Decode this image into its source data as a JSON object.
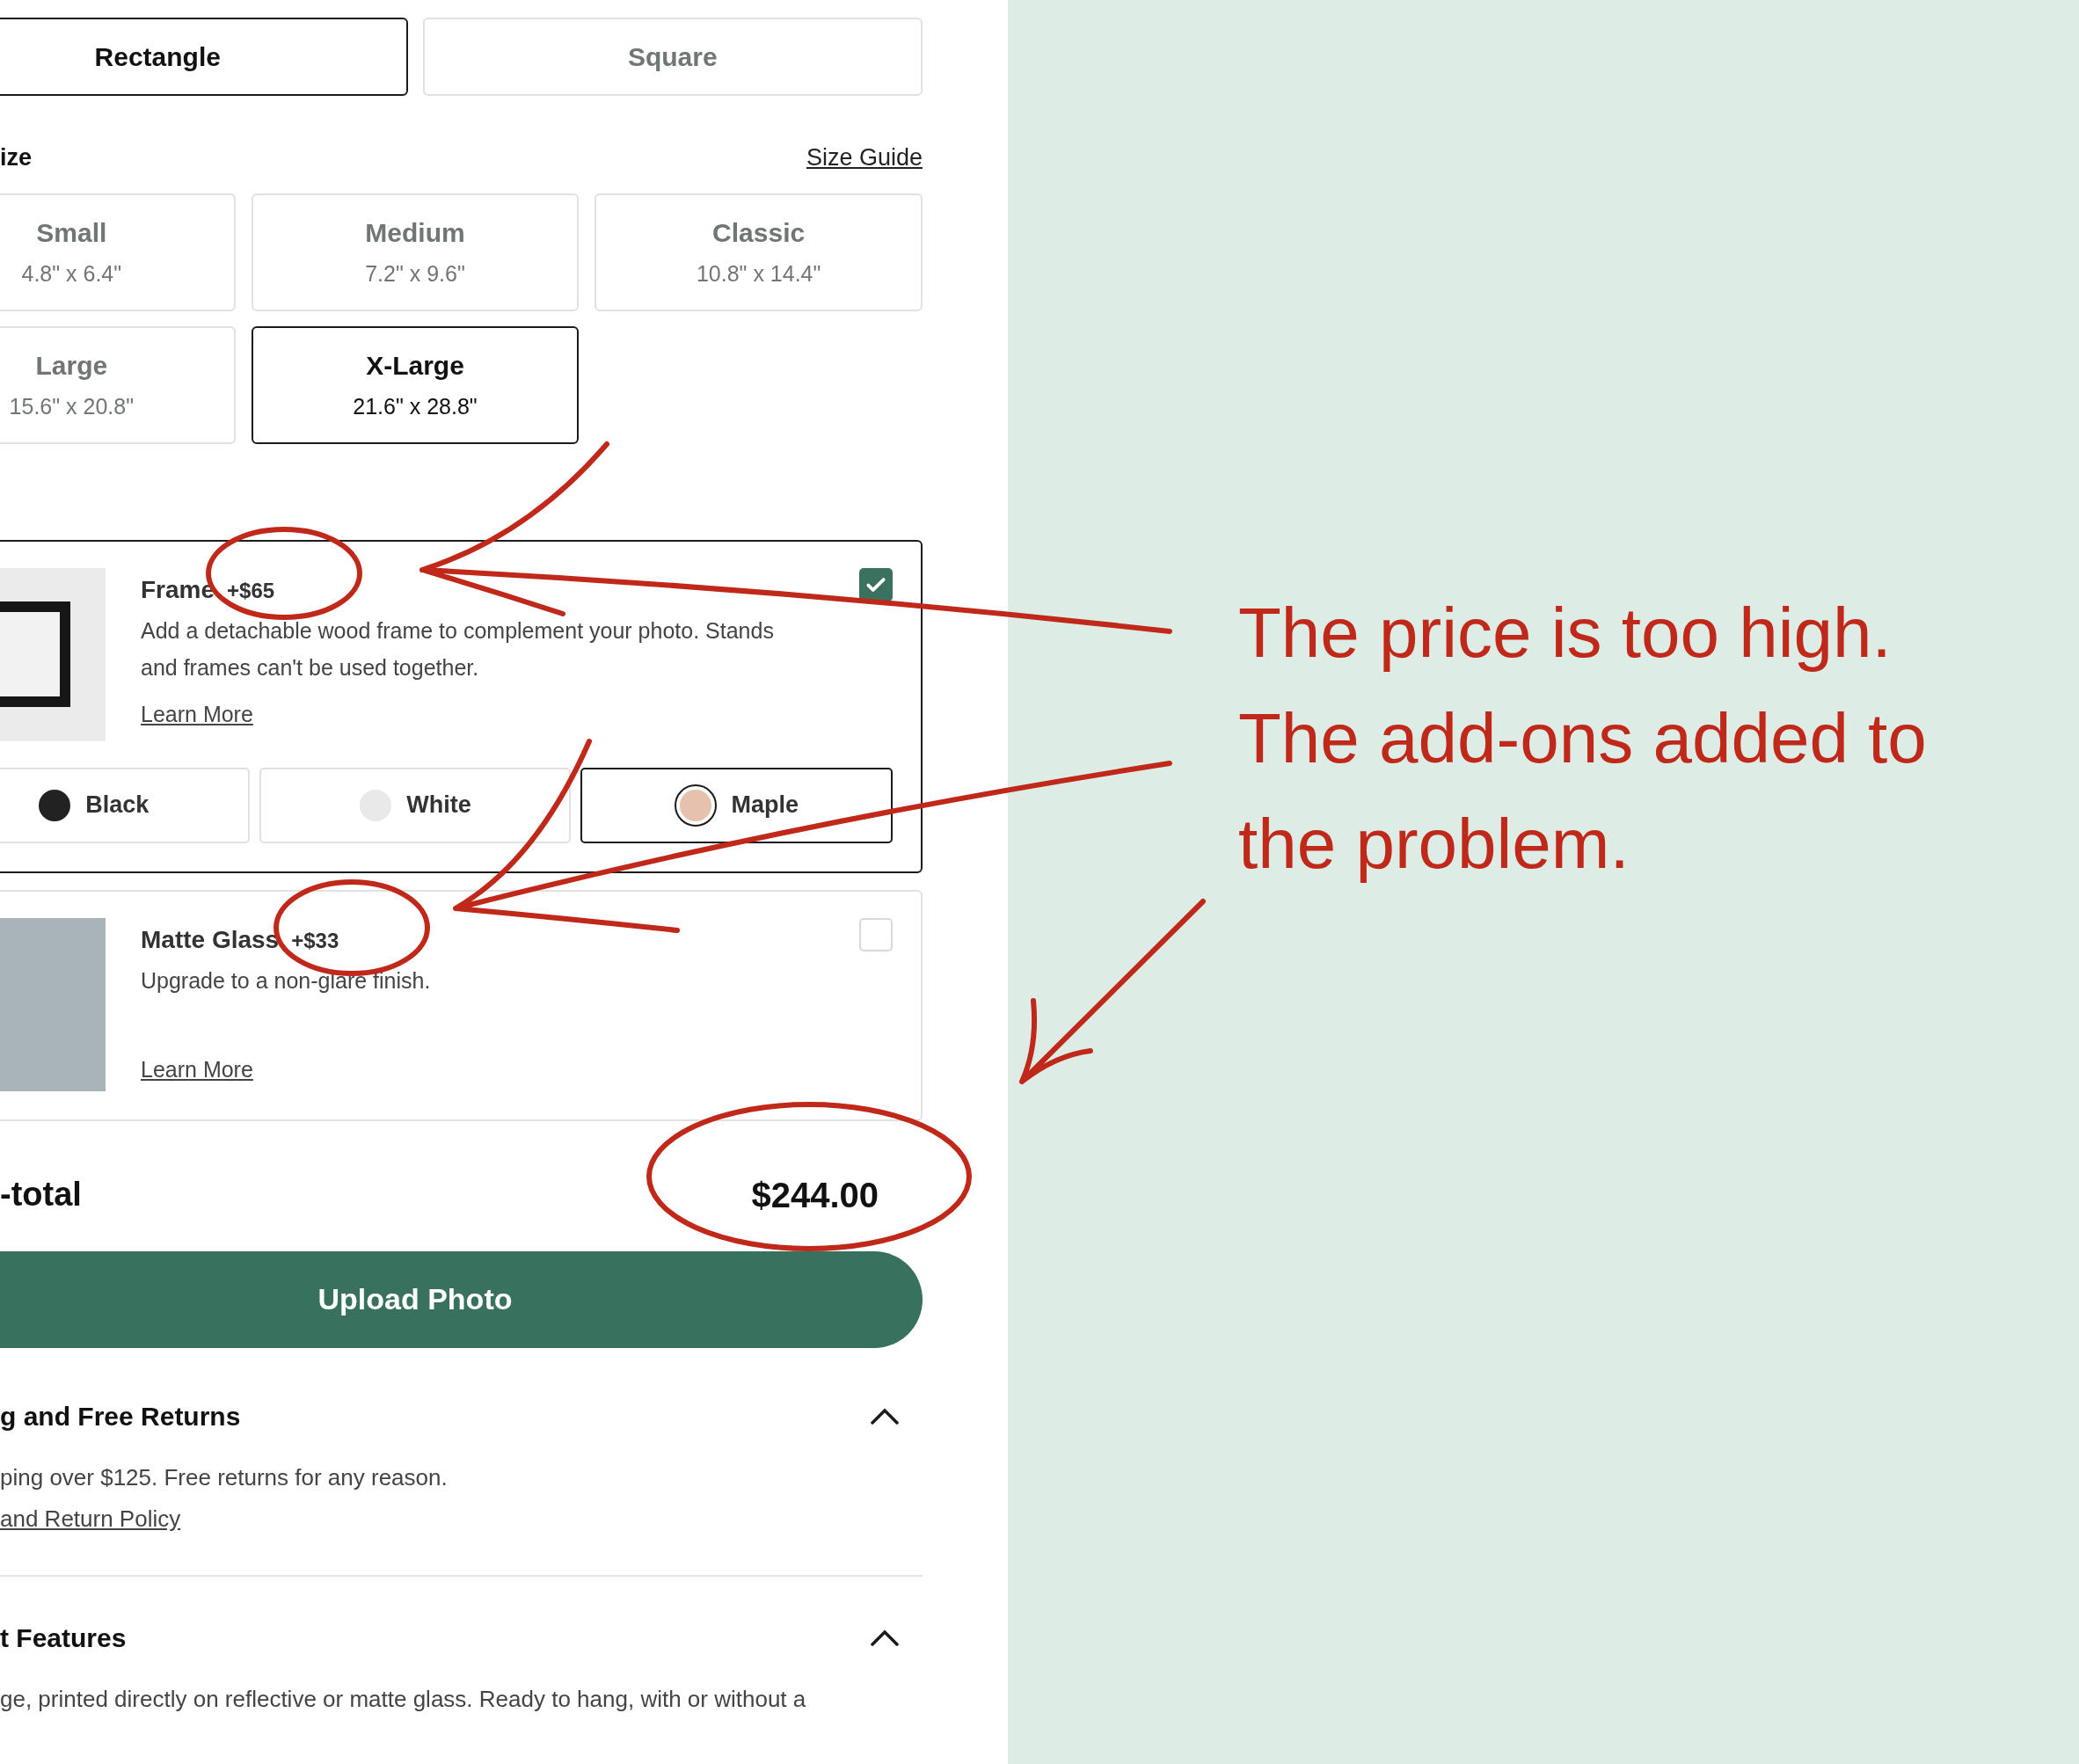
{
  "shape_tabs": [
    {
      "label": "Rectangle",
      "selected": true
    },
    {
      "label": "Square",
      "selected": false
    }
  ],
  "size": {
    "label": "ize",
    "guide_link": "Size Guide",
    "options": [
      {
        "name": "Small",
        "dims": "4.8\" x 6.4\"",
        "selected": false
      },
      {
        "name": "Medium",
        "dims": "7.2\" x 9.6\"",
        "selected": false
      },
      {
        "name": "Classic",
        "dims": "10.8\" x 14.4\"",
        "selected": false
      },
      {
        "name": "Large",
        "dims": "15.6\" x 20.8\"",
        "selected": false
      },
      {
        "name": "X-Large",
        "dims": "21.6\" x 28.8\"",
        "selected": true
      }
    ]
  },
  "addons": [
    {
      "kind": "frame",
      "title": "Frame",
      "price": "+$65",
      "description": "Add a detachable wood frame to complement your photo. Stands and frames can't be used together.",
      "link": "Learn More",
      "checked": true,
      "colors": [
        {
          "name": "Black",
          "color": "#222222",
          "selected": false
        },
        {
          "name": "White",
          "color": "#e9e9e9",
          "selected": false
        },
        {
          "name": "Maple",
          "color": "#e6c2ae",
          "selected": true
        }
      ]
    },
    {
      "kind": "photo",
      "title": "Matte Glass",
      "price": "+$33",
      "description": "Upgrade to a non-glare finish.",
      "link": "Learn More",
      "checked": false
    }
  ],
  "subtotal": {
    "label": "-total",
    "value": "$244.00"
  },
  "upload_button": "Upload Photo",
  "accordions": [
    {
      "title": "g and Free Returns",
      "expanded": true,
      "text": "ping over $125. Free returns for any reason.",
      "link": "and Return Policy"
    },
    {
      "title": "t Features",
      "expanded": true,
      "text": "ge, printed directly on reflective or matte glass. Ready to hang, with or without a"
    }
  ],
  "annotation": {
    "lines": [
      "The price is too high.",
      "The add-ons added to",
      "the problem."
    ]
  }
}
